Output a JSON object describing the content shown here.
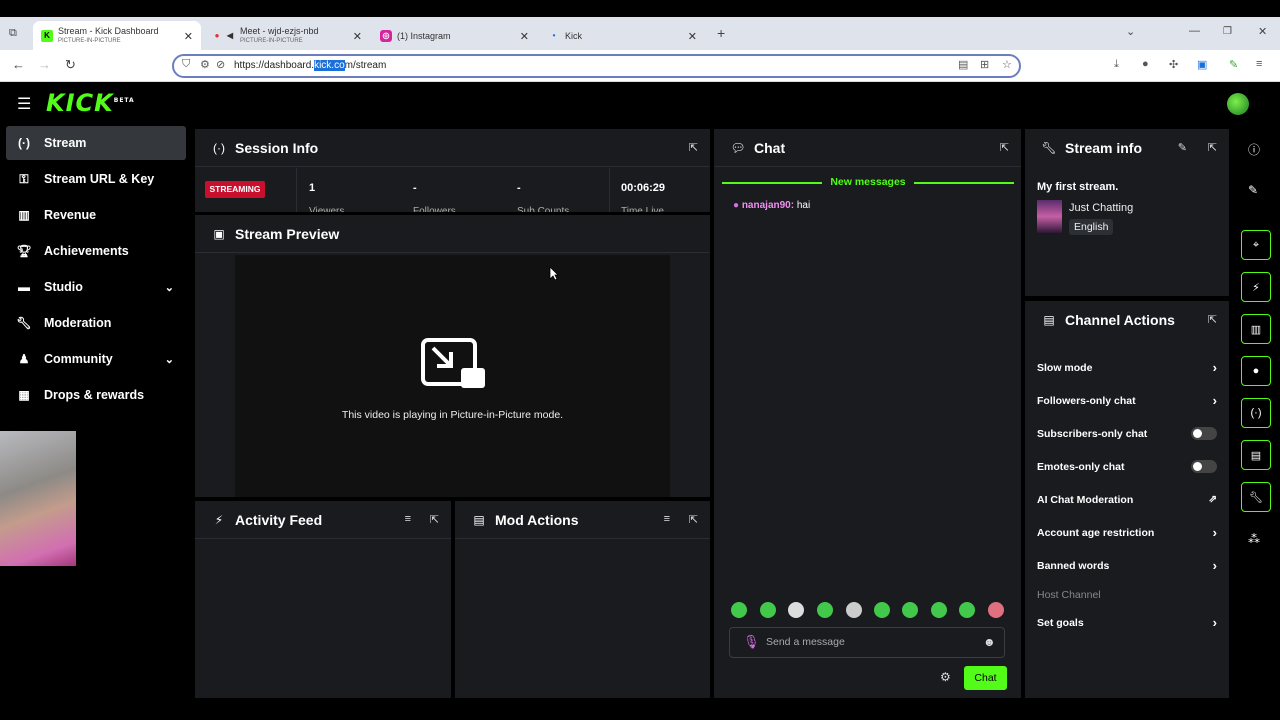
{
  "browser": {
    "tabs": [
      {
        "title": "Stream - Kick Dashboard",
        "subtitle": "PICTURE-IN-PICTURE",
        "icon": "kick-favicon"
      },
      {
        "title": "Meet - wjd-ezjs-nbd",
        "subtitle": "PICTURE-IN-PICTURE",
        "icon": "meet-favicon"
      },
      {
        "title": "(1) Instagram",
        "subtitle": "",
        "icon": "instagram-favicon"
      },
      {
        "title": "Kick",
        "subtitle": "",
        "icon": "dot-favicon"
      }
    ],
    "url_pre": "https://dashboard.",
    "url_hl": "kick.co",
    "url_post": "m/stream"
  },
  "header": {
    "logo": "KICK",
    "logo_badge": "BETA"
  },
  "sidebar": {
    "items": [
      {
        "label": "Stream",
        "icon": "stream-icon"
      },
      {
        "label": "Stream URL & Key",
        "icon": "key-icon"
      },
      {
        "label": "Revenue",
        "icon": "bar-chart-icon"
      },
      {
        "label": "Achievements",
        "icon": "trophy-icon"
      },
      {
        "label": "Studio",
        "icon": "studio-icon"
      },
      {
        "label": "Moderation",
        "icon": "wrench-icon"
      },
      {
        "label": "Community",
        "icon": "community-icon"
      },
      {
        "label": "Drops & rewards",
        "icon": "drops-icon"
      }
    ]
  },
  "session": {
    "title": "Session Info",
    "status": "STREAMING",
    "stats": [
      {
        "value": "1",
        "label": "Viewers"
      },
      {
        "value": "-",
        "label": "Followers"
      },
      {
        "value": "-",
        "label": "Sub Counts"
      },
      {
        "value": "00:06:29",
        "label": "Time Live"
      }
    ]
  },
  "preview": {
    "title": "Stream Preview",
    "pip_text": "This video is playing in Picture-in-Picture mode."
  },
  "activity": {
    "title": "Activity Feed"
  },
  "modactions": {
    "title": "Mod Actions"
  },
  "chat": {
    "title": "Chat",
    "new_messages": "New messages",
    "message_user": "nanajan90:",
    "message_text": " hai",
    "placeholder": "Send a message",
    "send_label": "Chat"
  },
  "streaminfo": {
    "title": "Stream info",
    "stream_title": "My first stream.",
    "category": "Just Chatting",
    "language": "English"
  },
  "channel_actions": {
    "title": "Channel Actions",
    "items": [
      {
        "label": "Slow mode",
        "control": "arrow"
      },
      {
        "label": "Followers-only chat",
        "control": "arrow"
      },
      {
        "label": "Subscribers-only chat",
        "control": "toggle",
        "on": false
      },
      {
        "label": "Emotes-only chat",
        "control": "toggle",
        "on": false
      },
      {
        "label": "AI Chat Moderation",
        "control": "external"
      },
      {
        "label": "Account age restriction",
        "control": "arrow"
      },
      {
        "label": "Banned words",
        "control": "arrow"
      },
      {
        "label": "Host Channel",
        "control": "none"
      },
      {
        "label": "Set goals",
        "control": "arrow"
      }
    ]
  },
  "colors": {
    "accent": "#53fc18",
    "live": "#c8102e",
    "panel": "#191b1f"
  }
}
